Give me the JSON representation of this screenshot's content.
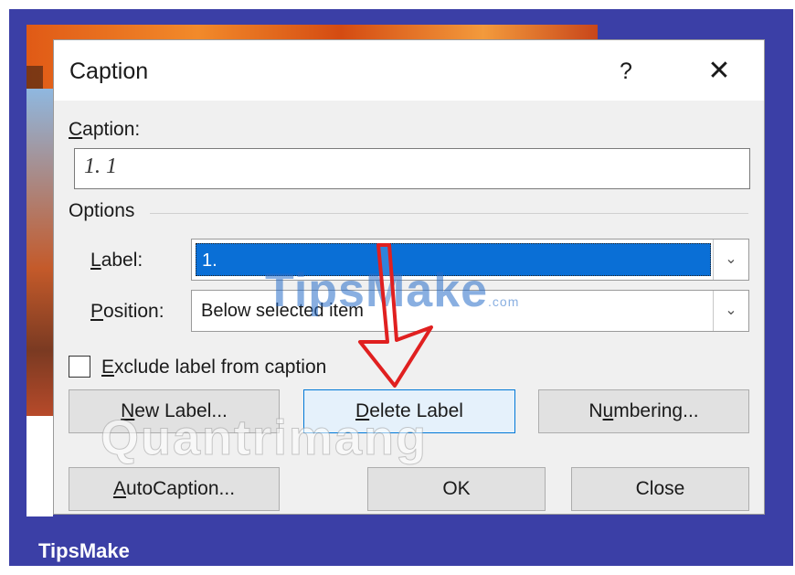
{
  "dialog": {
    "title": "Caption",
    "help_label": "?",
    "close_label": "✕"
  },
  "caption": {
    "label": "Caption:",
    "value": "1. 1"
  },
  "options": {
    "group_label": "Options",
    "label_field": {
      "label": "Label:",
      "value": "1."
    },
    "position_field": {
      "label": "Position:",
      "value": "Below selected item"
    },
    "exclude_checkbox": {
      "label": "Exclude label from caption",
      "checked": false
    }
  },
  "buttons": {
    "new_label": "New Label...",
    "delete_label": "Delete Label",
    "numbering": "Numbering...",
    "autocaption": "AutoCaption...",
    "ok": "OK",
    "close": "Close"
  },
  "watermarks": {
    "tipsmake_main": "TipsMake",
    "tipsmake_suffix": ".com",
    "quantrimang": "Quantrimang"
  },
  "footer": {
    "brand": "TipsMake"
  },
  "colors": {
    "frame": "#3b3fa6",
    "selection": "#0a6fd6",
    "arrow": "#e02020"
  }
}
